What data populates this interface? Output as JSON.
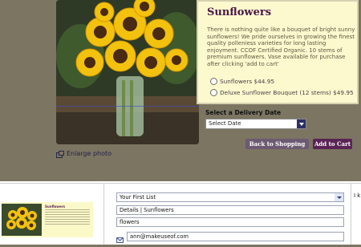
{
  "product": {
    "title": "Sunflowers",
    "description": "There is nothing quite like a bouquet of bright sunny sunflowers! We pride ourselves in growing the finest quality polleniess varieties for long lasting enjoyment. CCOF Certified Organic. 10 stems of premium sunflowers. Vase available for purchase after clicking 'add to cart'",
    "options": [
      {
        "label": "Sunflowers $44.95"
      },
      {
        "label": "Deluxe Sunflower Bouquet (12 stems) $49.95"
      }
    ],
    "enlarge_label": "Enlarge photo"
  },
  "delivery": {
    "label": "Select a Delivery Date",
    "selected": "Select Date"
  },
  "buttons": {
    "back": "Back to Shopping",
    "cart": "Add to Cart"
  },
  "clip": {
    "list": "Your First List",
    "title": "Details | Sunflowers",
    "tags": "flowers",
    "email": "ann@makeuseof.com",
    "right_text": "I k",
    "thumb_title": "Sunflowers"
  },
  "colors": {
    "backdrop": "#7c7562",
    "popup": "#fdf9cf",
    "title": "#4a1747",
    "cart_button": "#5a2355",
    "back_button": "#6d5a72"
  }
}
